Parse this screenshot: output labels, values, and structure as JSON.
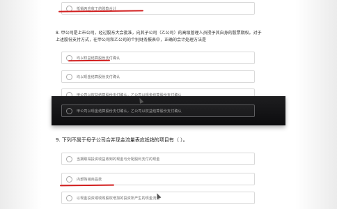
{
  "top_option": {
    "text": "抵销丙应收丁的账款合计"
  },
  "question8": {
    "title_line1": "8. 甲公司是上市公司，经过股东大会批准，向其子公司（乙公司）的高级管理人员授予其自身的股票期权。对于",
    "title_line2": "上述股份支付方式，在甲公司和乙公司的个别财务报表中，正确的会计处理方法是",
    "options": [
      "均以权益结算股份支付确认",
      "均以现金结算股份支付确认",
      "甲公司以权益结算股份支付确认，乙公司以现金结算股份支付确认",
      "甲公司以现金结算股份支付确认，乙公司以权益结算股份支付确认"
    ]
  },
  "question9": {
    "title": "9. 下列不属于母子公司合并现金流量表应抵销的项目有（ ）。",
    "options": [
      "当期取得投资收益收到的现金与分配股利支付的现金",
      "内部购销商品款",
      "以现金投资或收购股权增加的投资所产生的现金流量"
    ]
  },
  "colors": {
    "highlight": "#d21e1e",
    "band": "#141416",
    "border": "#d9d9d9"
  }
}
